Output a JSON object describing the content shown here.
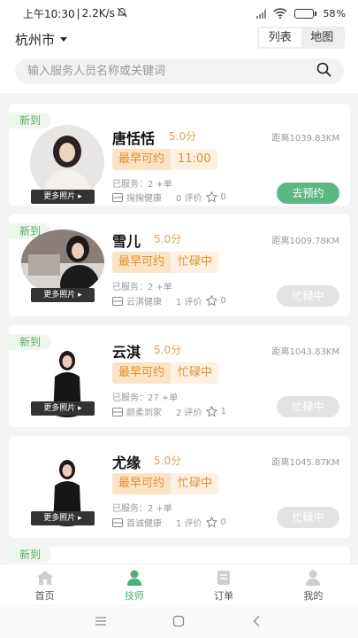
{
  "status": {
    "time": "上午10:30",
    "speed": "2.2K/s",
    "battery": "58"
  },
  "header": {
    "city": "杭州市",
    "view_tabs": [
      {
        "label": "列表",
        "active": true
      },
      {
        "label": "地图",
        "active": false
      }
    ],
    "search_placeholder": "输入服务人员名称或关键词"
  },
  "labels": {
    "new": "新到",
    "more_photos": "更多照片",
    "earliest": "最早可约",
    "book": "去预约",
    "busy": "忙碌中"
  },
  "workers": [
    {
      "name": "唐恬恬",
      "score": "5.0分",
      "distance": "距离1039.83KM",
      "availability": "11:00",
      "served": "已服务：2 +单",
      "store": "掬掬健康",
      "reviews": "0 评价",
      "rating": "0",
      "status": "book"
    },
    {
      "name": "雪儿",
      "score": "5.0分",
      "distance": "距离1009.78KM",
      "availability": "忙碌中",
      "served": "已服务：2 +单",
      "store": "云淇健康",
      "reviews": "1 评价",
      "rating": "0",
      "status": "busy"
    },
    {
      "name": "云淇",
      "score": "5.0分",
      "distance": "距离1043.83KM",
      "availability": "忙碌中",
      "served": "已服务：27 +单",
      "store": "颜柔到家",
      "reviews": "2 评价",
      "rating": "1",
      "status": "busy"
    },
    {
      "name": "尤缘",
      "score": "5.0分",
      "distance": "距离1045.87KM",
      "availability": "忙碌中",
      "served": "已服务：2 +单",
      "store": "首诚健康",
      "reviews": "1 评价",
      "rating": "0",
      "status": "busy"
    }
  ],
  "tabbar": [
    {
      "label": "首页",
      "icon": "home-icon",
      "active": false
    },
    {
      "label": "技师",
      "icon": "technician-icon",
      "active": true
    },
    {
      "label": "订单",
      "icon": "order-icon",
      "active": false
    },
    {
      "label": "我的",
      "icon": "profile-icon",
      "active": false
    }
  ],
  "colors": {
    "accent": "#4caf7a",
    "book_button": "#5ab880",
    "orange": "#e29030",
    "score": "#d9a457"
  }
}
